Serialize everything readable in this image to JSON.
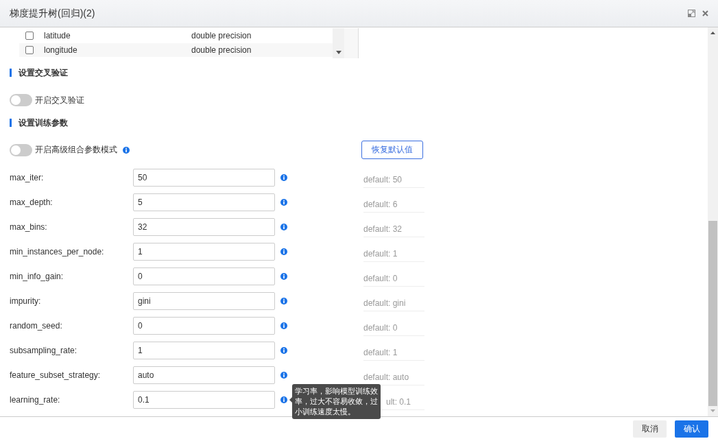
{
  "window": {
    "title": "梯度提升树(回归)(2)"
  },
  "column_table": {
    "rows": [
      {
        "name": "latitude",
        "type": "double precision",
        "checked": false
      },
      {
        "name": "longitude",
        "type": "double precision",
        "checked": false
      }
    ]
  },
  "cross_validation": {
    "heading": "设置交叉验证",
    "toggle": {
      "label": "开启交叉验证",
      "on": false,
      "info": false
    }
  },
  "training": {
    "heading": "设置训练参数",
    "toggle": {
      "label": "开启高级组合参数模式",
      "on": false,
      "info": true
    },
    "reset_button": "恢复默认值",
    "params": [
      {
        "label": "max_iter:",
        "value": "50",
        "default": "default: 50"
      },
      {
        "label": "max_depth:",
        "value": "5",
        "default": "default: 6"
      },
      {
        "label": "max_bins:",
        "value": "32",
        "default": "default: 32"
      },
      {
        "label": "min_instances_per_node:",
        "value": "1",
        "default": "default: 1"
      },
      {
        "label": "min_info_gain:",
        "value": "0",
        "default": "default: 0"
      },
      {
        "label": "impurity:",
        "value": "gini",
        "default": "default: gini"
      },
      {
        "label": "random_seed:",
        "value": "0",
        "default": "default: 0"
      },
      {
        "label": "subsampling_rate:",
        "value": "1",
        "default": "default: 1"
      },
      {
        "label": "feature_subset_strategy:",
        "value": "auto",
        "default": "default: auto"
      },
      {
        "label": "learning_rate:",
        "value": "0.1",
        "default": "ult: 0.1",
        "tooltip": "学习率，影响模型训练效率，过大不容易收敛，过小训练速度太慢。"
      }
    ]
  },
  "footer": {
    "buttons": [
      {
        "label": "取消",
        "kind": "secondary"
      },
      {
        "label": "确认",
        "kind": "primary"
      }
    ]
  }
}
